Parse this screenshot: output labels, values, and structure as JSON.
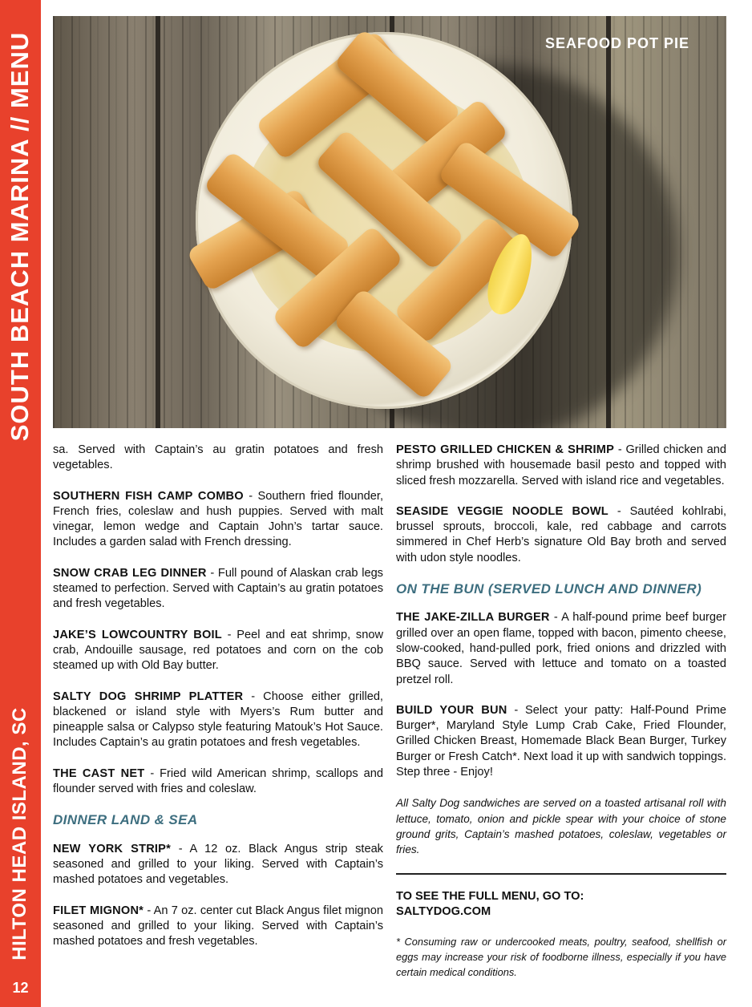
{
  "sidebar": {
    "title": "SOUTH BEACH MARINA // MENU",
    "location": "HILTON HEAD ISLAND, SC",
    "page_number": "12"
  },
  "photo": {
    "caption": "SEAFOOD POT PIE"
  },
  "left_column": {
    "continued_text": "sa. Served with Captain’s au gratin potatoes and fresh vegetables.",
    "items": [
      {
        "name": "SOUTHERN FISH CAMP COMBO",
        "desc": " - Southern fried flounder, French fries, coleslaw and hush puppies. Served with malt vinegar, lemon wedge and Captain John’s tartar sauce.  Includes a garden salad with French dressing."
      },
      {
        "name": "SNOW CRAB LEG DINNER",
        "desc": " - Full pound of Alaskan crab legs steamed to perfection. Served with Captain’s au gratin potatoes and fresh vegetables."
      },
      {
        "name": "JAKE’S LOWCOUNTRY BOIL",
        "desc": " - Peel and eat shrimp, snow crab, Andouille sausage, red potatoes and corn on the cob steamed up with Old Bay butter."
      },
      {
        "name": "SALTY DOG SHRIMP PLATTER",
        "desc": " - Choose either grilled, blackened or island style with Myers’s Rum butter and pineapple salsa or Calypso style featuring Matouk’s Hot Sauce. Includes Captain’s au gratin potatoes and fresh vegetables."
      },
      {
        "name": "THE CAST  NET",
        "desc": " - Fried wild American shrimp, scallops and flounder served with fries and coleslaw."
      }
    ],
    "section_heading": "DINNER LAND & SEA",
    "section_items": [
      {
        "name": "NEW YORK STRIP*",
        "desc": "  - A 12 oz. Black Angus strip steak seasoned and grilled to your liking. Served with Captain’s mashed potatoes and vegetables."
      },
      {
        "name": "FILET MIGNON*",
        "desc": " - An 7 oz. center cut Black Angus filet mignon seasoned and grilled to your liking. Served with Captain’s mashed potatoes and fresh vegetables."
      }
    ]
  },
  "right_column": {
    "items": [
      {
        "name": "PESTO GRILLED CHICKEN & SHRIMP",
        "desc": " - Grilled chicken and shrimp brushed with housemade basil pesto and topped with sliced fresh mozzarella. Served with island rice and vegetables."
      },
      {
        "name": "SEASIDE VEGGIE NOODLE BOWL",
        "desc": " - Sautéed kohlrabi, brussel sprouts, broccoli, kale, red cabbage and carrots simmered in Chef Herb’s signature Old Bay broth and served with udon style noodles."
      }
    ],
    "section_heading": "ON THE BUN (SERVED LUNCH AND DINNER)",
    "section_items": [
      {
        "name": "THE JAKE-ZILLA BURGER",
        "desc": " - A half-pound prime beef burger grilled over an open flame, topped with bacon, pimento cheese, slow-cooked, hand-pulled pork, fried onions and drizzled with BBQ sauce. Served with lettuce and tomato on a toasted pretzel roll."
      },
      {
        "name": "BUILD YOUR BUN",
        "desc": " - Select your patty: Half-Pound Prime Burger*, Maryland Style Lump Crab Cake, Fried Flounder, Grilled Chicken Breast, Homemade Black Bean Burger, Turkey Burger or Fresh Catch*. Next load it up with sandwich toppings. Step three - Enjoy!"
      }
    ],
    "sandwich_note": "All Salty Dog sandwiches are served on a toasted artisanal roll with lettuce, tomato, onion and pickle spear with your choice of stone ground grits, Captain’s mashed potatoes, coleslaw, vegetables or fries.",
    "cta_line1": "TO SEE THE FULL MENU, GO TO:",
    "cta_line2": "SALTYDOG.COM",
    "disclaimer": "* Consuming raw or undercooked meats, poultry, seafood, shellfish or eggs may increase your risk of foodborne illness, especially if you have certain medical conditions."
  },
  "colors": {
    "sidebar_red": "#e8412c",
    "section_heading_teal": "#3d6e7f"
  }
}
